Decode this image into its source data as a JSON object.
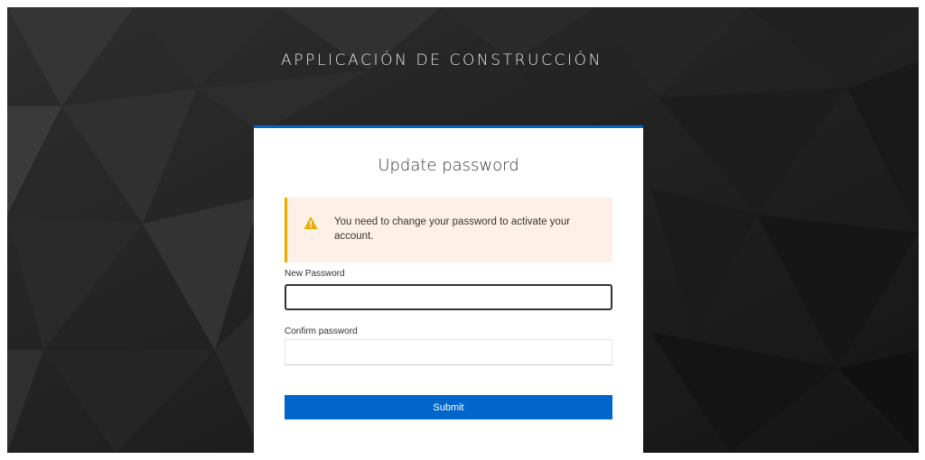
{
  "app": {
    "title": "APPLICACIÓN DE CONSTRUCCIÓN"
  },
  "card": {
    "title": "Update password",
    "accent_color": "#0066cc",
    "alert": {
      "icon": "warning-triangle-icon",
      "color": "#f0ab00",
      "message": "You need to change your password to activate your account."
    },
    "fields": {
      "new_password": {
        "label": "New Password",
        "value": ""
      },
      "confirm_password": {
        "label": "Confirm password",
        "value": ""
      }
    },
    "submit_label": "Submit"
  }
}
